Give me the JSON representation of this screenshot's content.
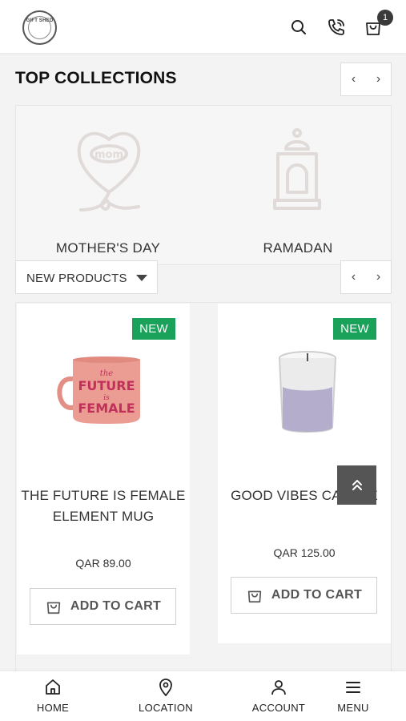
{
  "header": {
    "logo_text": "GIFT SHED",
    "cart_count": "1"
  },
  "collections": {
    "title": "TOP COLLECTIONS",
    "items": [
      {
        "label": "MOTHER'S DAY",
        "icon": "heart-mom-icon"
      },
      {
        "label": "RAMADAN",
        "icon": "lantern-icon"
      }
    ]
  },
  "products_filter": {
    "selected": "NEW PRODUCTS"
  },
  "products": [
    {
      "badge": "NEW",
      "name": "THE FUTURE IS FEMALE ELEMENT MUG",
      "price": "QAR 89.00",
      "cart_label": "ADD TO CART"
    },
    {
      "badge": "NEW",
      "name": "GOOD VIBES CANDLE",
      "price": "QAR 125.00",
      "cart_label": "ADD TO CART"
    }
  ],
  "bottom_nav": [
    {
      "label": "HOME",
      "icon": "home-icon"
    },
    {
      "label": "LOCATION",
      "icon": "location-pin-icon"
    },
    {
      "label": "ACCOUNT",
      "icon": "user-icon"
    },
    {
      "label": "MENU",
      "icon": "hamburger-menu-icon"
    }
  ],
  "colors": {
    "new_badge": "#1aa25a",
    "scroll_top_bg": "#555555",
    "page_bg": "#f4f3f3"
  }
}
